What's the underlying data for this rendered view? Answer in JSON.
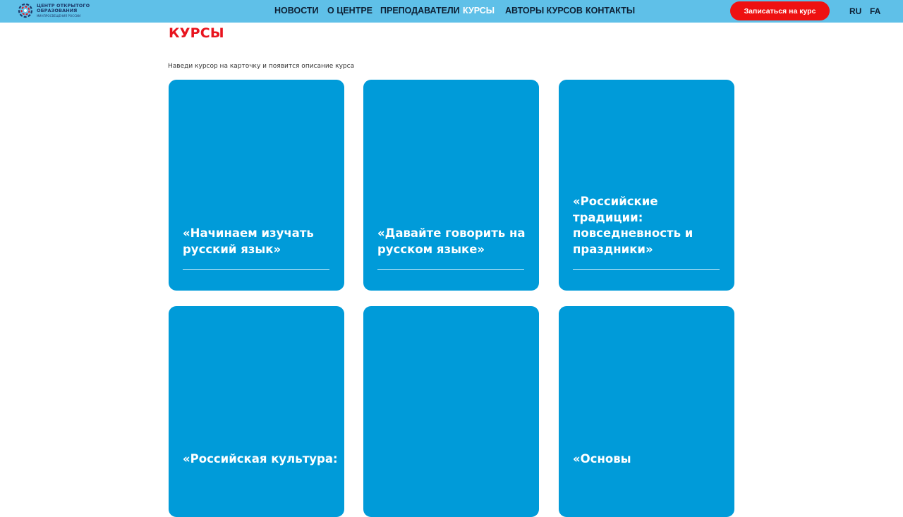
{
  "header": {
    "logo": {
      "line1": "ЦЕНТР ОТКРЫТОГО",
      "line2": "ОБРАЗОВАНИЯ",
      "line3": "МИНПРОСВЕЩЕНИЯ РОССИИ"
    },
    "nav": [
      {
        "label": "НОВОСТИ",
        "active": false
      },
      {
        "label": "О ЦЕНТРЕ",
        "active": false
      },
      {
        "label": "ПРЕПОДАВАТЕЛИ",
        "active": false
      },
      {
        "label": "КУРСЫ",
        "active": true
      },
      {
        "label": "АВТОРЫ КУРСОВ",
        "active": false
      },
      {
        "label": "КОНТАКТЫ",
        "active": false
      }
    ],
    "cta_label": "Записаться на курс",
    "languages": [
      "RU",
      "FA"
    ]
  },
  "page": {
    "title": "КУРСЫ",
    "hint": "Наведи курсор на карточку и появится описание курса"
  },
  "cards": [
    {
      "title": "«Начинаем изучать русский язык»"
    },
    {
      "title": "«Давайте говорить на русском языке»"
    },
    {
      "title": "«Российские традиции: повседневность и праздники»"
    },
    {
      "title": "«Российская культура:"
    },
    {
      "title": ""
    },
    {
      "title": "«Основы"
    }
  ],
  "colors": {
    "header_bg": "#5fc0e8",
    "card_bg": "#009bd9",
    "accent_red": "#e8141e",
    "cta_bg": "#ee1111"
  }
}
